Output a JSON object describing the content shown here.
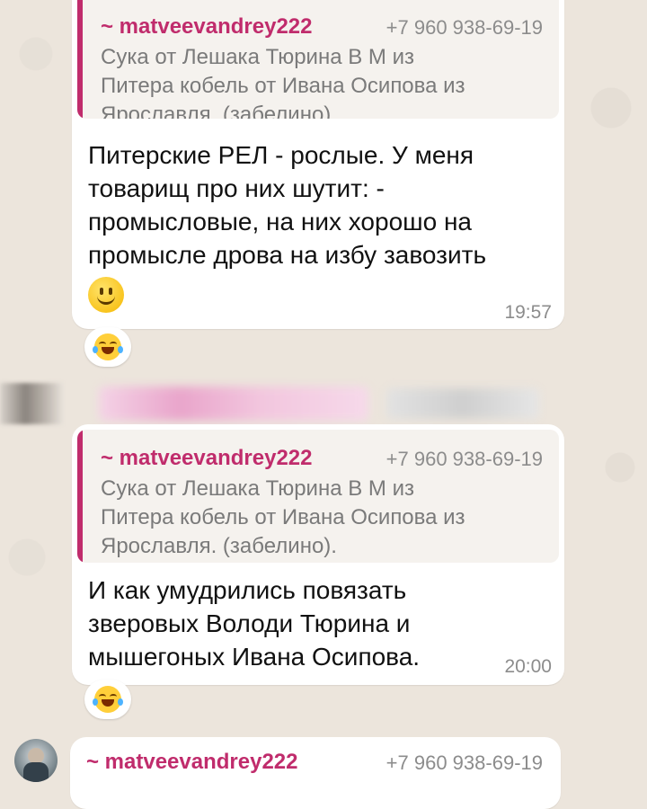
{
  "messages": [
    {
      "quote": {
        "author": "~ matveevandrey222",
        "phone": "+7 960 938-69-19",
        "text": "Сука от Лешака  Тюрина В М из\nПитера  кобель от Ивана Осипова  из\nЯрославля. (забелино)."
      },
      "text": "Питерские РЕЛ - рослые. У меня\nтоварищ про них шутит: -\nпромысловые, на них хорошо на\nпромысле дрова на избу завозить",
      "emoji": "slightly-smiling-face",
      "time": "19:57",
      "reaction": "face-with-tears-of-joy"
    },
    {
      "quote": {
        "author": "~ matveevandrey222",
        "phone": "+7 960 938-69-19",
        "text": "Сука от Лешака  Тюрина В М из\nПитера  кобель от Ивана Осипова  из\nЯрославля. (забелино)."
      },
      "text": "И как умудрились повязать\nзверовых Володи Тюрина и\nмышегоных Ивана Осипова.",
      "time": "20:00",
      "reaction": "face-with-tears-of-joy"
    },
    {
      "sender": "~ matveevandrey222",
      "phone": "+7 960 938-69-19"
    }
  ],
  "colors": {
    "background": "#ece5dc",
    "bubble": "#ffffff",
    "quote_accent": "#c02c6c",
    "muted_text": "#8c8c8c"
  }
}
